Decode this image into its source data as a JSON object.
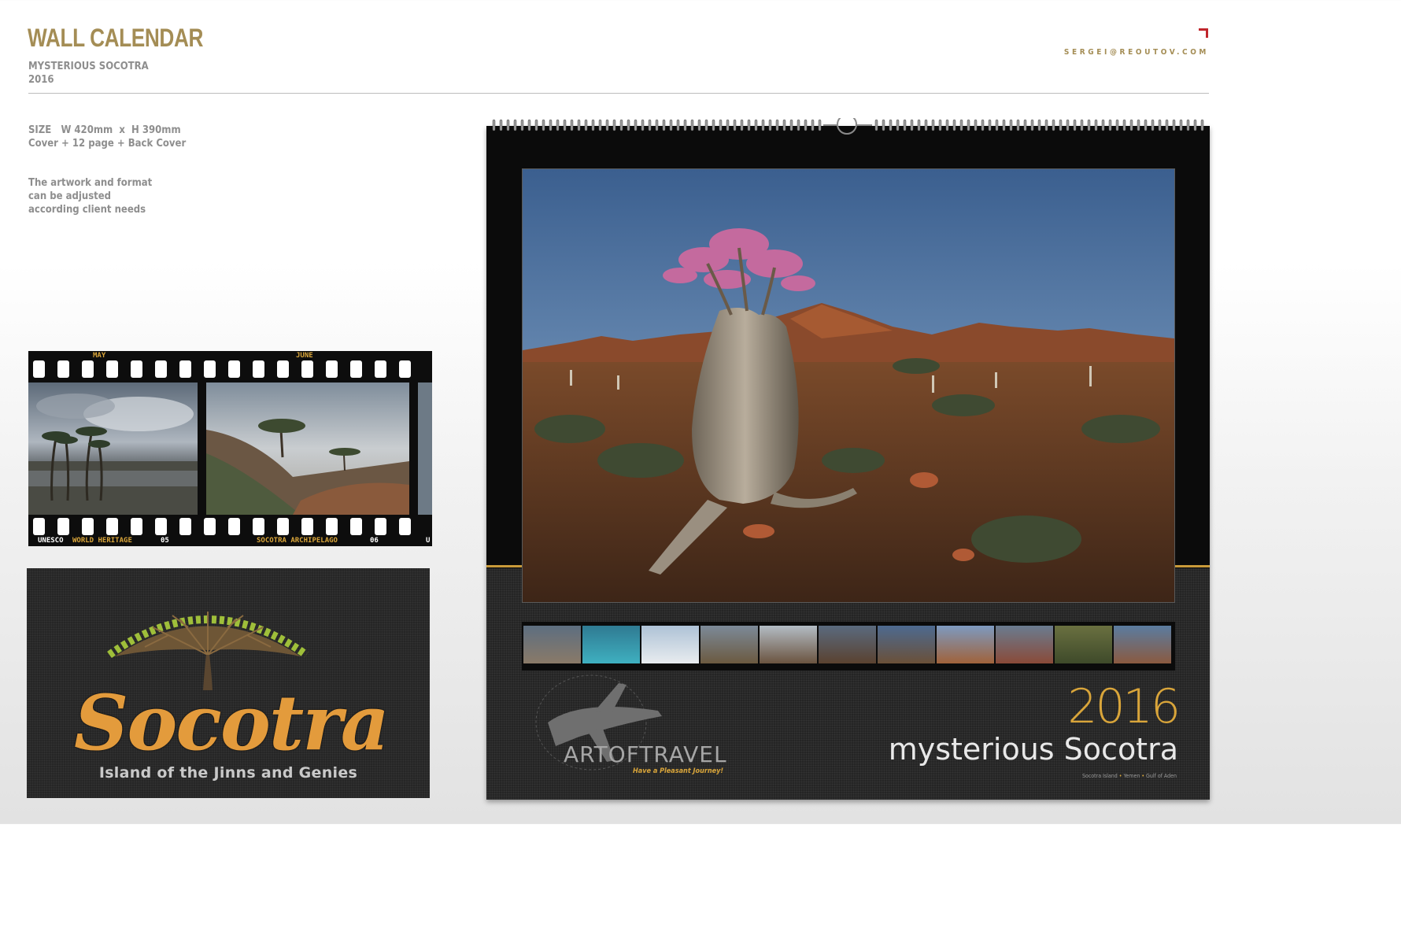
{
  "header": {
    "title": "WALL CALENDAR",
    "subtitle": "MYSTERIOUS SOCOTRA",
    "year": "2016",
    "email": "SERGEI@REOUTOV.COM"
  },
  "specs": {
    "size_line": "SIZE   W 420mm  x  H 390mm",
    "pages_line": "Cover + 12 page + Back Cover",
    "note_lines": [
      "The artwork and format",
      "can be adjusted",
      "according client needs"
    ]
  },
  "film_strip": {
    "top_labels": [
      "MAY",
      "JUNE"
    ],
    "bottom_left_white": "UNESCO",
    "bottom_left_gold": "WORLD HERITAGE",
    "bottom_num_1": "05",
    "bottom_right_gold": "SOCOTRA ARCHIPELAGO",
    "bottom_num_2": "06",
    "bottom_cut": "U"
  },
  "logo_card": {
    "word": "Socotra",
    "tagline": "Island of the Jinns and Genies"
  },
  "calendar": {
    "year": "2016",
    "title": "mysterious Socotra",
    "location_parts": [
      "Socotra Island",
      "Yemen",
      "Gulf of Aden"
    ],
    "brand": "ARTOFTRAVEL",
    "brand_tagline": "Have a Pleasant Journey!",
    "thumb_count": 11
  },
  "colors": {
    "gold": "#a48d55",
    "accent_gold": "#d9a53a",
    "orange": "#e39b3c",
    "corner_red": "#c0262c"
  }
}
